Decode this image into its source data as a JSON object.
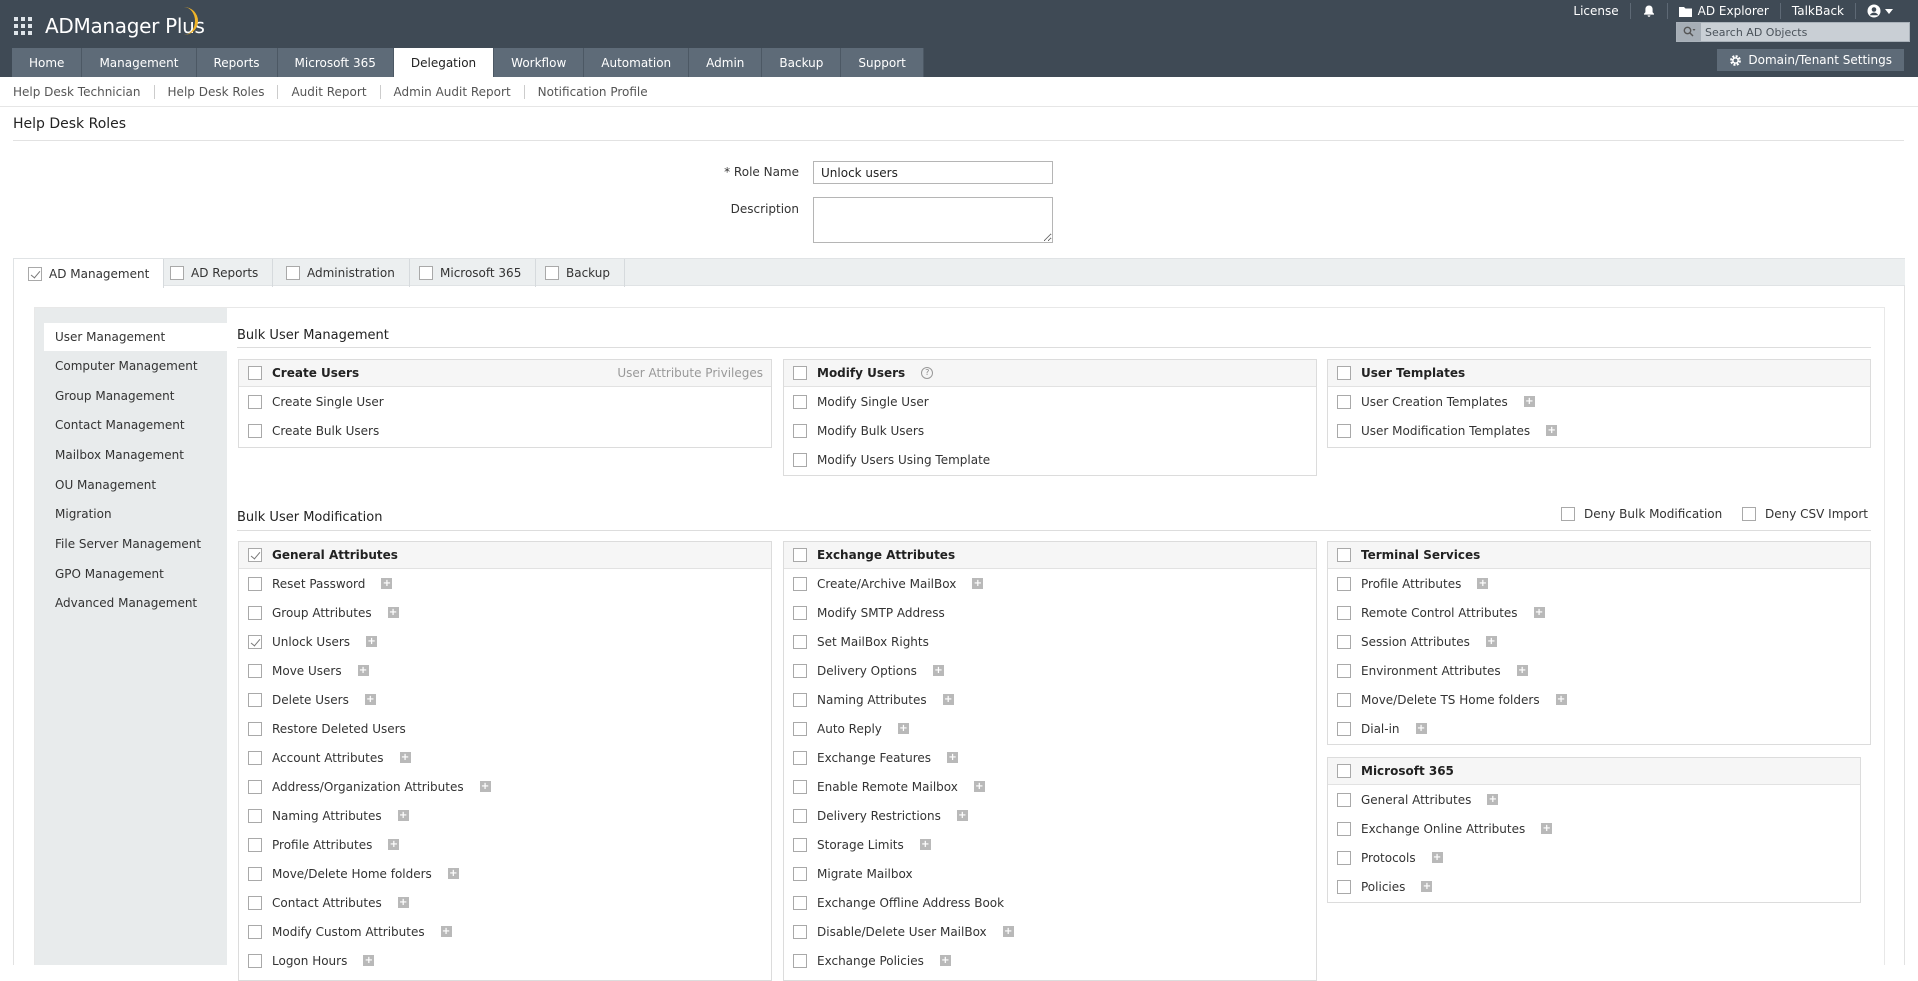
{
  "app": {
    "name": "ADManager Plus"
  },
  "header": {
    "links": {
      "license": "License",
      "ad_explorer": "AD Explorer",
      "talkback": "TalkBack"
    },
    "search_placeholder": "Search AD Objects",
    "domain_settings": "Domain/Tenant Settings"
  },
  "nav": {
    "tabs": [
      "Home",
      "Management",
      "Reports",
      "Microsoft 365",
      "Delegation",
      "Workflow",
      "Automation",
      "Admin",
      "Backup",
      "Support"
    ],
    "active": "Delegation"
  },
  "subnav": [
    "Help Desk Technician",
    "Help Desk Roles",
    "Audit Report",
    "Admin Audit Report",
    "Notification Profile"
  ],
  "page": {
    "title": "Help Desk Roles"
  },
  "form": {
    "role_name_label": "* Role Name",
    "role_name_value": "Unlock users",
    "description_label": "Description",
    "description_value": ""
  },
  "module_tabs": [
    {
      "label": "AD Management",
      "checked": true
    },
    {
      "label": "AD Reports",
      "checked": false
    },
    {
      "label": "Administration",
      "checked": false
    },
    {
      "label": "Microsoft 365",
      "checked": false
    },
    {
      "label": "Backup",
      "checked": false
    }
  ],
  "left_menu": [
    "User Management",
    "Computer Management",
    "Group Management",
    "Contact Management",
    "Mailbox Management",
    "OU Management",
    "Migration",
    "File Server Management",
    "GPO Management",
    "Advanced Management"
  ],
  "bulk_user_management": {
    "title": "Bulk User Management",
    "create": {
      "title": "Create Users",
      "privileges_link": "User Attribute Privileges",
      "items": [
        "Create Single User",
        "Create Bulk Users"
      ]
    },
    "modify": {
      "title": "Modify Users",
      "items": [
        "Modify Single User",
        "Modify Bulk Users",
        "Modify Users Using Template"
      ]
    },
    "templates": {
      "title": "User Templates",
      "items": [
        "User Creation Templates",
        "User Modification Templates"
      ]
    }
  },
  "bulk_user_modification": {
    "title": "Bulk User Modification",
    "deny_bulk": "Deny Bulk Modification",
    "deny_csv": "Deny CSV Import",
    "general": {
      "title": "General Attributes",
      "checked": true,
      "items": [
        {
          "label": "Reset Password",
          "checked": false,
          "expand": true
        },
        {
          "label": "Group Attributes",
          "checked": false,
          "expand": true
        },
        {
          "label": "Unlock Users",
          "checked": true,
          "expand": true
        },
        {
          "label": "Move Users",
          "checked": false,
          "expand": true
        },
        {
          "label": "Delete Users",
          "checked": false,
          "expand": true
        },
        {
          "label": "Restore Deleted Users",
          "checked": false,
          "expand": false
        },
        {
          "label": "Account Attributes",
          "checked": false,
          "expand": true
        },
        {
          "label": "Address/Organization Attributes",
          "checked": false,
          "expand": true
        },
        {
          "label": "Naming Attributes",
          "checked": false,
          "expand": true
        },
        {
          "label": "Profile Attributes",
          "checked": false,
          "expand": true
        },
        {
          "label": "Move/Delete Home folders",
          "checked": false,
          "expand": true
        },
        {
          "label": "Contact Attributes",
          "checked": false,
          "expand": true
        },
        {
          "label": "Modify Custom Attributes",
          "checked": false,
          "expand": true
        },
        {
          "label": "Logon Hours",
          "checked": false,
          "expand": true
        }
      ]
    },
    "exchange": {
      "title": "Exchange Attributes",
      "items": [
        {
          "label": "Create/Archive MailBox",
          "expand": true
        },
        {
          "label": "Modify SMTP Address",
          "expand": false
        },
        {
          "label": "Set MailBox Rights",
          "expand": false
        },
        {
          "label": "Delivery Options",
          "expand": true
        },
        {
          "label": "Naming Attributes",
          "expand": true
        },
        {
          "label": "Auto Reply",
          "expand": true
        },
        {
          "label": "Exchange Features",
          "expand": true
        },
        {
          "label": "Enable Remote Mailbox",
          "expand": true
        },
        {
          "label": "Delivery Restrictions",
          "expand": true
        },
        {
          "label": "Storage Limits",
          "expand": true
        },
        {
          "label": "Migrate Mailbox",
          "expand": false
        },
        {
          "label": "Exchange Offline Address Book",
          "expand": false
        },
        {
          "label": "Disable/Delete User MailBox",
          "expand": true
        },
        {
          "label": "Exchange Policies",
          "expand": true
        }
      ]
    },
    "terminal": {
      "title": "Terminal Services",
      "items": [
        {
          "label": "Profile Attributes",
          "expand": true
        },
        {
          "label": "Remote Control Attributes",
          "expand": true
        },
        {
          "label": "Session Attributes",
          "expand": true
        },
        {
          "label": "Environment Attributes",
          "expand": true
        },
        {
          "label": "Move/Delete TS Home folders",
          "expand": true
        },
        {
          "label": "Dial-in",
          "expand": true
        }
      ]
    },
    "m365": {
      "title": "Microsoft 365",
      "items": [
        {
          "label": "General Attributes",
          "expand": true
        },
        {
          "label": "Exchange Online Attributes",
          "expand": true
        },
        {
          "label": "Protocols",
          "expand": true
        },
        {
          "label": "Policies",
          "expand": true
        }
      ]
    }
  }
}
